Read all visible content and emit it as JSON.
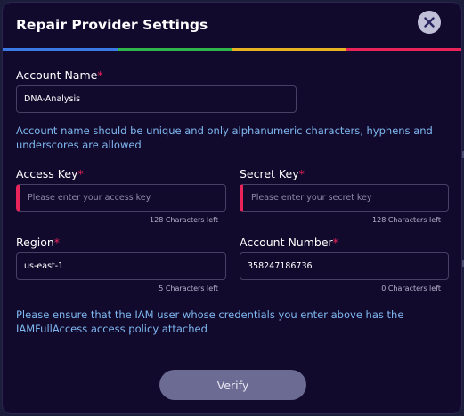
{
  "dialog": {
    "title": "Repair Provider Settings",
    "close_icon": "close-icon",
    "rainbow_colors": [
      "#3b79e5",
      "#2fb64b",
      "#e7b122",
      "#e8245a"
    ]
  },
  "form": {
    "account_name": {
      "label": "Account Name",
      "required_mark": "*",
      "value": "DNA-Analysis"
    },
    "account_name_hint": "Account name should be unique and only alphanumeric characters, hyphens and underscores are allowed",
    "access_key": {
      "label": "Access Key",
      "required_mark": "*",
      "value": "",
      "placeholder": "Please enter your access key",
      "counter": "128 Characters left"
    },
    "secret_key": {
      "label": "Secret Key",
      "required_mark": "*",
      "value": "",
      "placeholder": "Please enter your secret key",
      "counter": "128 Characters left"
    },
    "region": {
      "label": "Region",
      "required_mark": "*",
      "value": "us-east-1",
      "counter": "5 Characters left"
    },
    "account_number": {
      "label": "Account Number",
      "required_mark": "*",
      "value": "358247186736",
      "counter": "0 Characters left"
    },
    "iam_note": "Please ensure that the IAM user whose credentials you enter above has the IAMFullAccess access policy attached"
  },
  "actions": {
    "verify_label": "Verify"
  },
  "colors": {
    "background": "#120a2d",
    "required": "#e8245a",
    "note": "#7fb8f0",
    "button": "#6c6b93"
  }
}
